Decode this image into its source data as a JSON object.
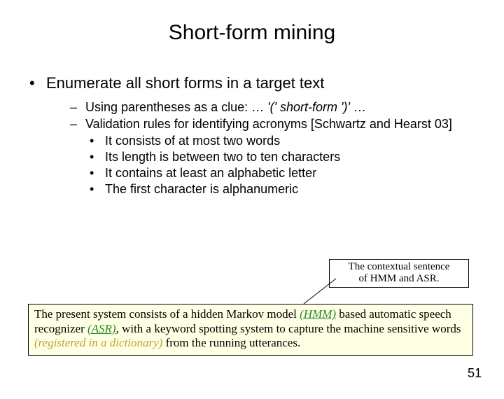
{
  "title": "Short-form mining",
  "main_bullet": "Enumerate all short forms in a target text",
  "sub1_prefix": "Using parentheses as a clue:   … ",
  "sub1_italic": "'(' short-form ')'",
  "sub1_suffix": " …",
  "sub2": "Validation rules for identifying acronyms [Schwartz and Hearst 03]",
  "rules": {
    "r1": "It consists of at most two words",
    "r2": "Its length is between two to ten characters",
    "r3": "It contains at least an alphabetic letter",
    "r4": "The first character is alphanumeric"
  },
  "callout_line1": "The contextual sentence",
  "callout_line2": "of HMM and ASR.",
  "example": {
    "p1": "The present system consists of a hidden Markov model ",
    "g1": "(HMM)",
    "p2": " based automatic speech recognizer ",
    "g2": "(ASR)",
    "p3": ", with a keyword spotting system to capture the machine sensitive words ",
    "gold": "(registered in a dictionary)",
    "p4": " from the running utterances."
  },
  "page_number": "51"
}
